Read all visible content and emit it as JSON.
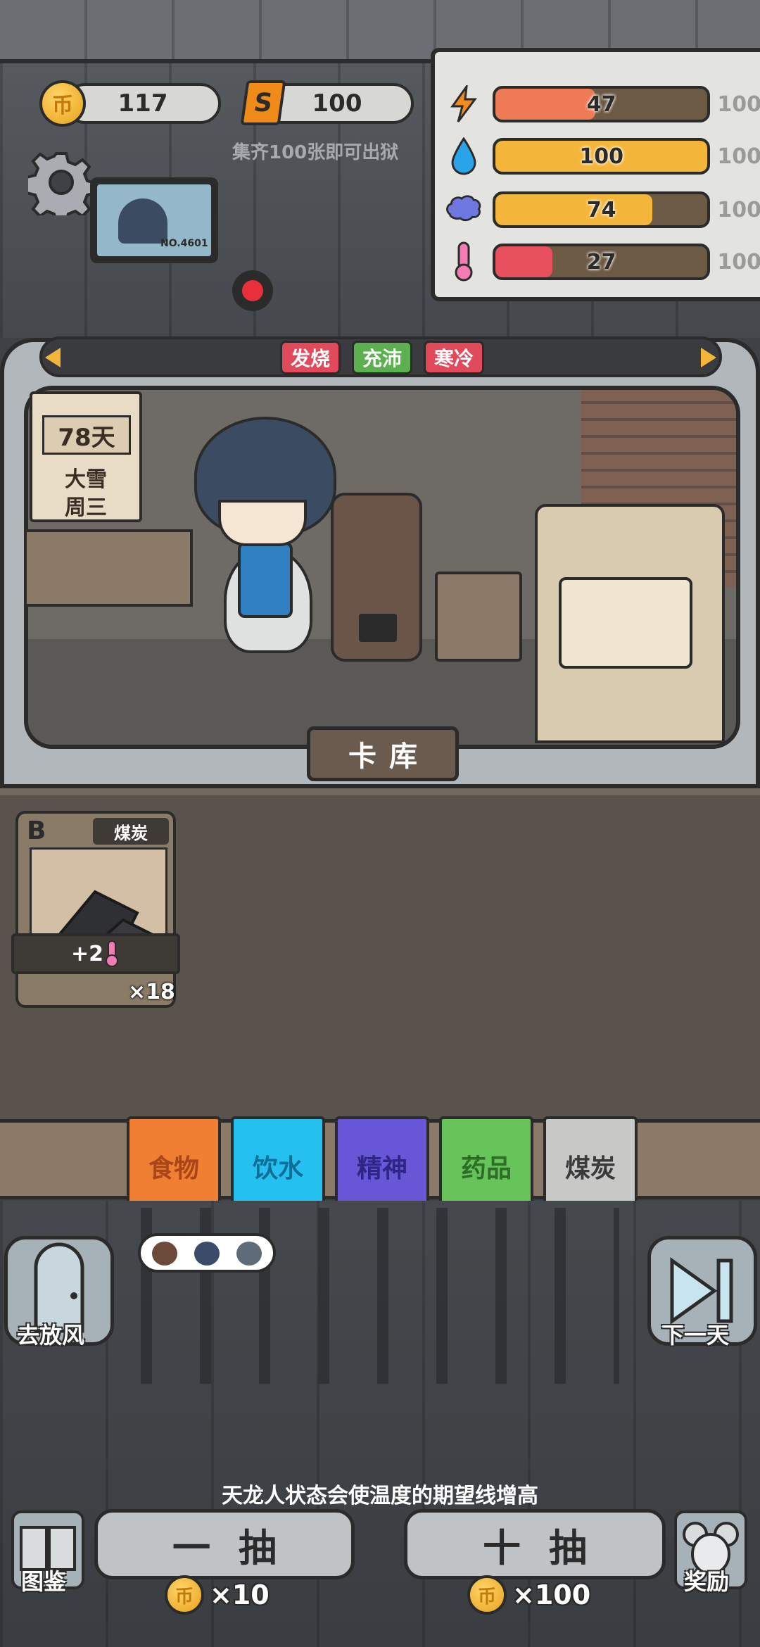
{
  "currency": {
    "coins": "117",
    "coin_icon_label": "币",
    "s_coins": "100",
    "s_icon_label": "S",
    "hint": "集齐100张即可出狱"
  },
  "stats": [
    {
      "icon": "lightning-icon",
      "value": "47",
      "max": "100",
      "fill": 0.47,
      "color": "#ee7b55"
    },
    {
      "icon": "water-drop-icon",
      "value": "100",
      "max": "100",
      "fill": 1.0,
      "color": "#f4b63a"
    },
    {
      "icon": "brain-icon",
      "value": "74",
      "max": "100",
      "fill": 0.74,
      "color": "#f4b63a"
    },
    {
      "icon": "thermometer-icon",
      "value": "27",
      "max": "100",
      "fill": 0.27,
      "color": "#e8505d"
    }
  ],
  "monitor": {
    "id": "NO.4601"
  },
  "tags": [
    {
      "label": "发烧",
      "color": "#e14a5b"
    },
    {
      "label": "充沛",
      "color": "#5cb04f"
    },
    {
      "label": "寒冷",
      "color": "#e14a5b"
    }
  ],
  "calendar": {
    "day": "78天",
    "weather": "大雪",
    "weekday": "周三"
  },
  "card_library_label": "卡库",
  "card": {
    "rank": "B",
    "name": "煤炭",
    "effect": "+2",
    "count": "×18"
  },
  "categories": [
    {
      "label": "食物",
      "color": "#f07f34",
      "text": "#a8461a"
    },
    {
      "label": "饮水",
      "color": "#23c0f0",
      "text": "#0e6e97"
    },
    {
      "label": "精神",
      "color": "#6757d6",
      "text": "#2e2585"
    },
    {
      "label": "药品",
      "color": "#66c45a",
      "text": "#2d6d25"
    },
    {
      "label": "煤炭",
      "color": "#c8c8c6",
      "text": "#3a3a3a"
    }
  ],
  "actions": {
    "go_out": "去放风",
    "next_day": "下一天",
    "codex": "图鉴",
    "reward": "奖励"
  },
  "tip": "天龙人状态会使温度的期望线增高",
  "draw": {
    "single_label": "一抽",
    "single_cost": "×10",
    "ten_label": "十抽",
    "ten_cost": "×100"
  }
}
